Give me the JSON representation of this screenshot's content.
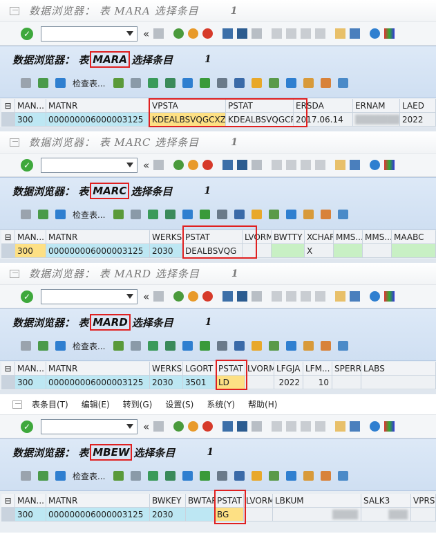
{
  "title": "数据浏览器： 表 MARA 选择条目",
  "title_count": "1",
  "title2": "数据浏览器： 表 MARC 选择条目",
  "title3": "数据浏览器： 表 MARD 选择条目",
  "menu": [
    "表条目(T)",
    "编辑(E)",
    "转到(G)",
    "设置(S)",
    "系统(Y)",
    "帮助(H)"
  ],
  "toolbar_label": "检查表...",
  "prefix": "数据浏览器： 表",
  "suffix": "选择条目",
  "colors": {
    "key_cell": "#bde7f3",
    "selected_cell": "#fde084",
    "highlight": "#e02020",
    "header_band": "#d5e3f4"
  },
  "sections": [
    {
      "table": "MARA",
      "count": "1",
      "headers": [
        "MAN...",
        "MATNR",
        "VPSTA",
        "PSTAT",
        "ERSDA",
        "ERNAM",
        "LAED"
      ],
      "row": [
        "300",
        "000000006000003125",
        "KDEALBSVQGCXZP",
        "KDEALBSVQGCP",
        "2017.06.14",
        "",
        "2022"
      ]
    },
    {
      "table": "MARC",
      "count": "1",
      "headers": [
        "MAN...",
        "MATNR",
        "WERKS",
        "PSTAT",
        "LVORM",
        "BWTTY",
        "XCHAR",
        "MMS...",
        "MMS...",
        "MAABC"
      ],
      "row": [
        "300",
        "000000006000003125",
        "2030",
        "DEALBSVQG",
        "",
        "",
        "X",
        "",
        "",
        ""
      ]
    },
    {
      "table": "MARD",
      "count": "1",
      "headers": [
        "MAN...",
        "MATNR",
        "WERKS",
        "LGORT",
        "PSTAT",
        "LVORM",
        "LFGJA",
        "LFM...",
        "SPERR",
        "LABS"
      ],
      "row": [
        "300",
        "000000006000003125",
        "2030",
        "3501",
        "LD",
        "",
        "2022",
        "10",
        "",
        ""
      ]
    },
    {
      "table": "MBEW",
      "count": "1",
      "headers": [
        "MAN...",
        "MATNR",
        "BWKEY",
        "BWTAR",
        "PSTAT",
        "LVORM",
        "LBKUM",
        "SALK3",
        "VPRSV"
      ],
      "row": [
        "300",
        "000000006000003125",
        "2030",
        "",
        "BG",
        "",
        "",
        "",
        ""
      ]
    }
  ]
}
